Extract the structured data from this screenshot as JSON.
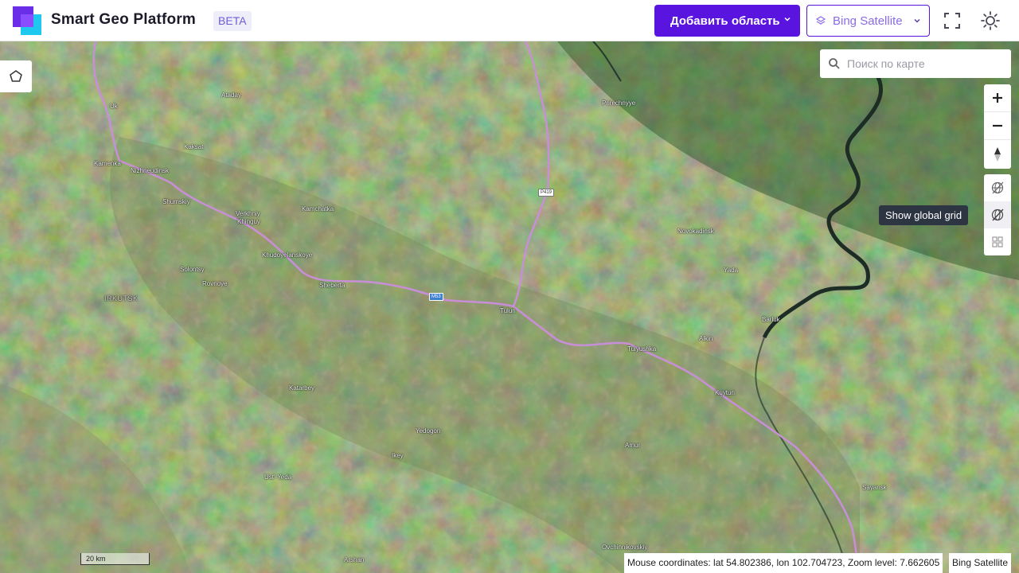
{
  "header": {
    "app_title": "Smart Geo Platform",
    "badge": "BETA",
    "add_area_label": "Добавить область",
    "layer_label": "Bing Satellite"
  },
  "icons": {
    "logo": "logo-icon",
    "chevron": "chevron-down-icon",
    "layers": "layers-icon",
    "fullscreen": "fullscreen-icon",
    "theme": "sun-icon",
    "polygon": "polygon-icon",
    "search": "search-icon",
    "zoom_in": "plus-icon",
    "zoom_out": "minus-icon",
    "compass": "compass-icon",
    "grid_off": "grid-hidden-icon",
    "grid": "grid-icon",
    "tiles": "tiles-icon"
  },
  "colors": {
    "brand": "#5a14e0",
    "logo_cyan": "#1ec8ee",
    "road": "#c98ed8",
    "tooltip_bg": "#2d3442"
  },
  "search": {
    "placeholder": "Поиск по карте"
  },
  "tooltip": "Show global grid",
  "map": {
    "places": [
      "Uk",
      "Ataday",
      "Kaksat",
      "Kamenka",
      "Nizhneudinsk",
      "Shumskiy",
      "Verkhniy",
      "Khinguy",
      "Kamchatka",
      "Khudoyelanskoye",
      "Solontsy",
      "Rovnoye",
      "IRKUTSK",
      "Sheberta",
      "Tulun",
      "Prirechnyye",
      "Novokadinsk",
      "Yada",
      "Barluk",
      "Alkin",
      "Tulyushka",
      "Kuytun",
      "Katarbey",
      "Yedogon",
      "Ikey",
      "Amur",
      "Ust'-Yeda",
      "Sayansk",
      "Ovchinnikovskiy",
      "Arshan"
    ],
    "shields": [
      "M53",
      "P419"
    ]
  },
  "scale_label": "20 km",
  "status": {
    "coords_text": "Mouse coordinates: lat 54.802386, lon 102.704723, Zoom level: 7.662605",
    "lat": 54.802386,
    "lon": 102.704723,
    "zoom": 7.662605
  },
  "attribution": "Bing Satellite"
}
